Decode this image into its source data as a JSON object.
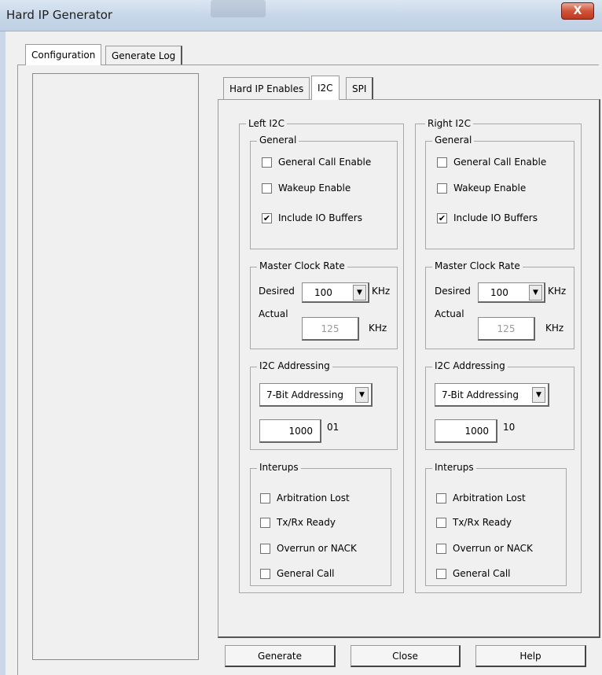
{
  "window": {
    "title": "Hard IP Generator",
    "close_glyph": "X"
  },
  "main_tabs": [
    {
      "label": "Configuration",
      "active": true
    },
    {
      "label": "Generate Log",
      "active": false
    }
  ],
  "sub_tabs": [
    {
      "label": "Hard IP Enables",
      "active": false
    },
    {
      "label": "I2C",
      "active": true
    },
    {
      "label": "SPI",
      "active": false
    }
  ],
  "left": {
    "title": "Left I2C",
    "general": {
      "title": "General",
      "general_call_enable": {
        "label": "General Call Enable",
        "checked": false
      },
      "wakeup_enable": {
        "label": "Wakeup Enable",
        "checked": false
      },
      "include_io_buffers": {
        "label": "Include IO Buffers",
        "checked": true
      }
    },
    "clock": {
      "title": "Master Clock Rate",
      "desired_label": "Desired",
      "desired_value": "100",
      "actual_label": "Actual",
      "actual_value": "125",
      "unit": "KHz"
    },
    "addressing": {
      "title": "I2C Addressing",
      "mode": "7-Bit Addressing",
      "address": "1000",
      "suffix": "01"
    },
    "interrupts": {
      "title": "Interups",
      "arbitration_lost": "Arbitration Lost",
      "txrx_ready": "Tx/Rx Ready",
      "overrun_nack": "Overrun or NACK",
      "general_call": "General Call"
    }
  },
  "right": {
    "title": "Right I2C",
    "general": {
      "title": "General",
      "general_call_enable": {
        "label": "General Call Enable",
        "checked": false
      },
      "wakeup_enable": {
        "label": "Wakeup Enable",
        "checked": false
      },
      "include_io_buffers": {
        "label": "Include IO Buffers",
        "checked": true
      }
    },
    "clock": {
      "title": "Master Clock Rate",
      "desired_label": "Desired",
      "desired_value": "100",
      "actual_label": "Actual",
      "actual_value": "125",
      "unit": "KHz"
    },
    "addressing": {
      "title": "I2C Addressing",
      "mode": "7-Bit Addressing",
      "address": "1000",
      "suffix": "10"
    },
    "interrupts": {
      "title": "Interups",
      "arbitration_lost": "Arbitration Lost",
      "txrx_ready": "Tx/Rx Ready",
      "overrun_nack": "Overrun or NACK",
      "general_call": "General Call"
    }
  },
  "buttons": {
    "generate": "Generate",
    "close": "Close",
    "help": "Help"
  },
  "icons": {
    "checkmark": "check-icon",
    "dropdown": "dropdown-arrow-icon"
  },
  "colors": {
    "close_button": "#c9452b",
    "titlebar": "#c6d6e8"
  }
}
